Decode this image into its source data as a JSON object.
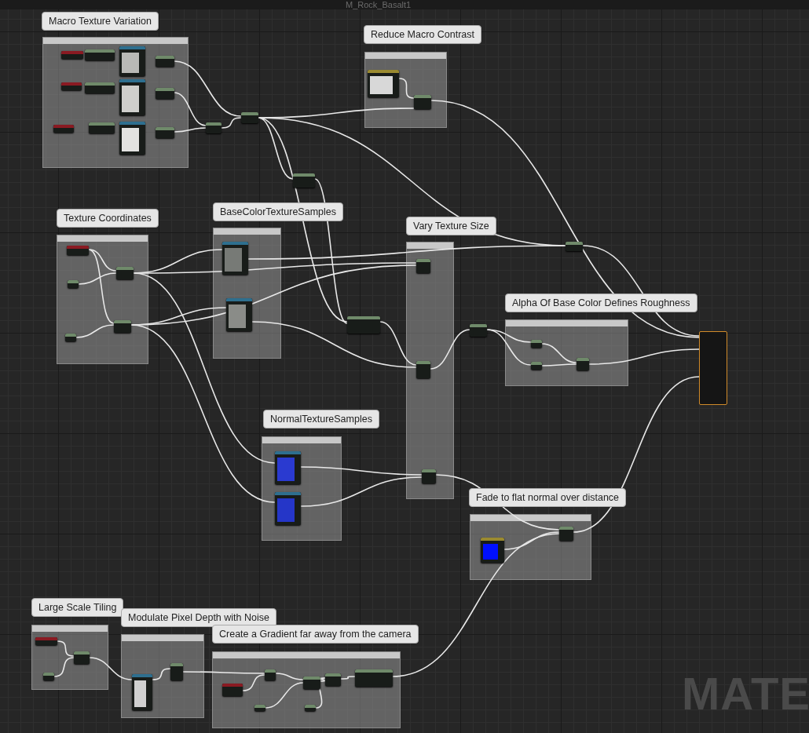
{
  "title": "M_Rock_Basalt1",
  "comments": [
    {
      "label": "Macro Texture Variation"
    },
    {
      "label": "Reduce Macro Contrast"
    },
    {
      "label": "Texture Coordinates"
    },
    {
      "label": "BaseColorTextureSamples"
    },
    {
      "label": "Vary Texture Size"
    },
    {
      "label": "Alpha Of Base Color Defines Roughness"
    },
    {
      "label": "NormalTextureSamples"
    },
    {
      "label": "Fade to flat normal over distance"
    },
    {
      "label": "Large Scale Tiling"
    },
    {
      "label": "Modulate Pixel Depth with Noise"
    },
    {
      "label": "Create a Gradient far away from the camera"
    }
  ],
  "watermark": "MATE"
}
